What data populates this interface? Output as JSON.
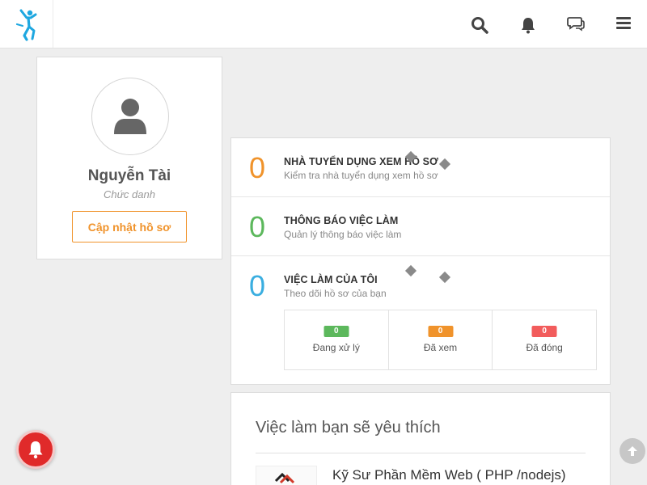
{
  "header": {
    "icons": [
      "runner-logo-icon",
      "search-icon",
      "bell-icon",
      "chat-icon",
      "hamburger-menu-icon"
    ]
  },
  "profile": {
    "name": "Nguyễn Tài",
    "title": "Chức danh",
    "update_button": "Cập nhật hồ sơ",
    "avatar_icon": "user-icon"
  },
  "stats": [
    {
      "count": "0",
      "title": "NHÀ TUYỂN DỤNG XEM HỒ SƠ",
      "subtitle": "Kiểm tra nhà tuyển dụng xem hồ sơ",
      "color": "#f0932b"
    },
    {
      "count": "0",
      "title": "THÔNG BÁO VIỆC LÀM",
      "subtitle": "Quản lý thông báo việc làm",
      "color": "#5cb85c"
    },
    {
      "count": "0",
      "title": "VIỆC LÀM CỦA TÔI",
      "subtitle": "Theo dõi hồ sơ của bạn",
      "color": "#3aaee0"
    }
  ],
  "my_jobs": [
    {
      "count": "0",
      "label": "Đang xử lý",
      "color": "#5cb85c"
    },
    {
      "count": "0",
      "label": "Đã xem",
      "color": "#f0932b"
    },
    {
      "count": "0",
      "label": "Đã đóng",
      "color": "#f25c5c"
    }
  ],
  "suggested": {
    "heading": "Việc làm bạn sẽ yêu thích",
    "jobs": [
      {
        "title": "Kỹ Sư Phần Mềm Web ( PHP /nodejs)"
      }
    ]
  },
  "colors": {
    "accent_orange": "#f0932b",
    "green": "#5cb85c",
    "blue": "#3aaee0",
    "red": "#f25c5c",
    "logo_blue": "#1ea7e0",
    "notification_red": "#e02a2a"
  }
}
